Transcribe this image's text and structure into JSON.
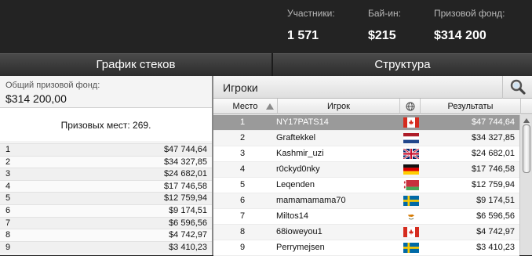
{
  "header": {
    "stats": [
      {
        "label": "Участники:",
        "value": "1 571"
      },
      {
        "label": "Бай-ин:",
        "value": "$215"
      },
      {
        "label": "Призовой фонд:",
        "value": "$314 200"
      }
    ]
  },
  "tabs": {
    "stacks_label": "График стеков",
    "structure_label": "Структура"
  },
  "left": {
    "pool_label": "Общий призовой фонд:",
    "pool_value": "$314 200,00",
    "places_text": "Призовых мест: 269.",
    "payouts": [
      {
        "place": "1",
        "amount": "$47 744,64"
      },
      {
        "place": "2",
        "amount": "$34 327,85"
      },
      {
        "place": "3",
        "amount": "$24 682,01"
      },
      {
        "place": "4",
        "amount": "$17 746,58"
      },
      {
        "place": "5",
        "amount": "$12 759,94"
      },
      {
        "place": "6",
        "amount": "$9 174,51"
      },
      {
        "place": "7",
        "amount": "$6 596,56"
      },
      {
        "place": "8",
        "amount": "$4 742,97"
      },
      {
        "place": "9",
        "amount": "$3 410,23"
      }
    ]
  },
  "players": {
    "title": "Игроки",
    "search_icon": "search-icon",
    "columns": {
      "place": "Место",
      "player": "Игрок",
      "flag": "globe-icon",
      "result": "Результаты"
    },
    "rows": [
      {
        "place": "1",
        "name": "NY17PATS14",
        "flag": "canada",
        "result": "$47 744,64",
        "selected": true
      },
      {
        "place": "2",
        "name": "Graftekkel",
        "flag": "netherlands",
        "result": "$34 327,85"
      },
      {
        "place": "3",
        "name": "Kashmir_uzi",
        "flag": "uk",
        "result": "$24 682,01"
      },
      {
        "place": "4",
        "name": "r0ckyd0nky",
        "flag": "germany",
        "result": "$17 746,58"
      },
      {
        "place": "5",
        "name": "Leqenden",
        "flag": "belarus",
        "result": "$12 759,94"
      },
      {
        "place": "6",
        "name": "mamamamama70",
        "flag": "sweden",
        "result": "$9 174,51"
      },
      {
        "place": "7",
        "name": "Miltos14",
        "flag": "cyprus",
        "result": "$6 596,56"
      },
      {
        "place": "8",
        "name": "68ioweyou1",
        "flag": "canada",
        "result": "$4 742,97"
      },
      {
        "place": "9",
        "name": "Perrymejsen",
        "flag": "sweden",
        "result": "$3 410,23"
      }
    ]
  }
}
